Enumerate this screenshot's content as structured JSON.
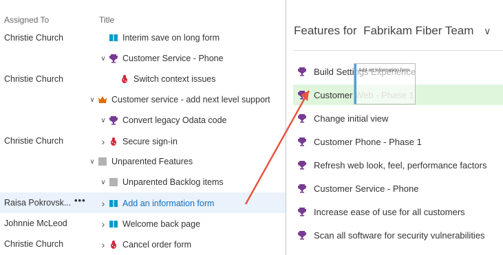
{
  "left": {
    "headers": {
      "assigned": "Assigned To",
      "title": "Title"
    },
    "rows": [
      {
        "assigned": "Christie Church",
        "chevron": "",
        "icon": "book-icon",
        "title": "Interim save on long form",
        "indent": 1
      },
      {
        "assigned": "",
        "chevron": "chevron-down-icon",
        "icon": "trophy-icon",
        "title": "Customer Service - Phone",
        "indent": 1
      },
      {
        "assigned": "Christie Church",
        "chevron": "",
        "icon": "bug-icon",
        "title": "Switch context issues",
        "indent": 2
      },
      {
        "assigned": "",
        "chevron": "chevron-down-icon",
        "icon": "crown-icon",
        "title": "Customer service - add next level support",
        "indent": 0
      },
      {
        "assigned": "",
        "chevron": "chevron-down-icon",
        "icon": "trophy-icon",
        "title": "Convert legacy Odata code",
        "indent": 1
      },
      {
        "assigned": "Christie Church",
        "chevron": "chevron-right-icon",
        "icon": "bug-icon",
        "title": "Secure sign-in",
        "indent": 1
      },
      {
        "assigned": "",
        "chevron": "chevron-down-icon",
        "icon": "gray-box-icon",
        "title": "Unparented Features",
        "indent": 0
      },
      {
        "assigned": "",
        "chevron": "chevron-down-icon",
        "icon": "gray-box-icon",
        "title": "Unparented Backlog items",
        "indent": 1
      },
      {
        "assigned": "Raisa Pokrovsk...",
        "chevron": "chevron-right-icon",
        "icon": "book-icon",
        "title": "Add an information form",
        "indent": 1,
        "selected": true,
        "more": "•••"
      },
      {
        "assigned": "Johnnie McLeod",
        "chevron": "chevron-right-icon",
        "icon": "book-icon",
        "title": "Welcome back page",
        "indent": 1
      },
      {
        "assigned": "Christie Church",
        "chevron": "chevron-right-icon",
        "icon": "bug-icon",
        "title": "Cancel order form",
        "indent": 1
      }
    ]
  },
  "right": {
    "title_prefix": "Features for",
    "team": "Fabrikam Fiber Team",
    "features": [
      {
        "label": "Build Settings Experience"
      },
      {
        "label_dark": "Customer",
        "label_faded": " Web - Phase 1",
        "highlight": true
      },
      {
        "label": "Change initial view"
      },
      {
        "label": "Customer Phone - Phase 1"
      },
      {
        "label": "Refresh web look, feel, performance factors"
      },
      {
        "label": "Customer Service - Phone"
      },
      {
        "label": "Increase ease of use for all customers"
      },
      {
        "label": "Scan all software for security vulnerabilities"
      }
    ]
  },
  "drag_tooltip": {
    "text": "Add an information form"
  },
  "colors": {
    "trophy": "#773b93",
    "bug": "#cc293d",
    "book": "#009ccc",
    "crown": "#e06c00",
    "gray": "#b2b2b2",
    "arrow": "#e8563f",
    "highlight": "#dff6dd",
    "selected": "#eaf2fb",
    "link": "#106ebe"
  }
}
